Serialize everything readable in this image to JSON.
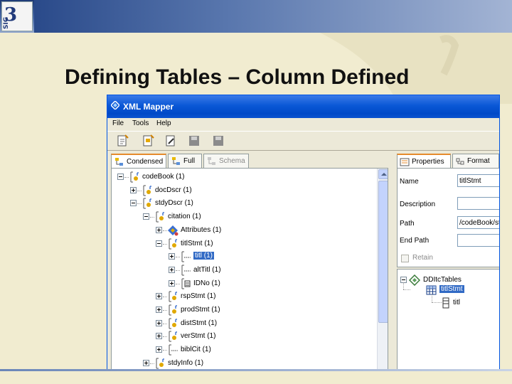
{
  "slide": {
    "title": "Defining Tables – Column Defined",
    "logo_text": "3",
    "logo_sub": "SIG"
  },
  "window": {
    "title": "XML Mapper",
    "menu": [
      "File",
      "Tools",
      "Help"
    ]
  },
  "left_tabs": [
    {
      "label": "Condensed",
      "icon": "tree-icon"
    },
    {
      "label": "Full",
      "icon": "tree-icon"
    },
    {
      "label": "Schema",
      "icon": "schema-icon"
    }
  ],
  "tree": [
    {
      "label": "codeBook (1)",
      "icon": "element-icon",
      "level": 0,
      "expander": "minus"
    },
    {
      "label": "docDscr (1)",
      "icon": "element-icon",
      "level": 1,
      "expander": "plus"
    },
    {
      "label": "stdyDscr (1)",
      "icon": "element-icon",
      "level": 1,
      "expander": "minus"
    },
    {
      "label": "citation (1)",
      "icon": "element-icon",
      "level": 2,
      "expander": "minus"
    },
    {
      "label": "Attributes (1)",
      "icon": "attributes-icon",
      "level": 3,
      "expander": "plus"
    },
    {
      "label": "titlStmt (1)",
      "icon": "element-icon",
      "level": 3,
      "expander": "minus"
    },
    {
      "label": "titl (1)",
      "icon": "text-icon",
      "level": 4,
      "expander": "plus",
      "selected": true
    },
    {
      "label": "altTitl (1)",
      "icon": "text-icon",
      "level": 4,
      "expander": "plus"
    },
    {
      "label": "IDNo (1)",
      "icon": "idno-icon",
      "level": 4,
      "expander": "plus"
    },
    {
      "label": "rspStmt (1)",
      "icon": "element-icon",
      "level": 3,
      "expander": "plus"
    },
    {
      "label": "prodStmt (1)",
      "icon": "element-icon",
      "level": 3,
      "expander": "plus"
    },
    {
      "label": "distStmt (1)",
      "icon": "element-icon",
      "level": 3,
      "expander": "plus"
    },
    {
      "label": "verStmt (1)",
      "icon": "element-icon",
      "level": 3,
      "expander": "plus"
    },
    {
      "label": "biblCit (1)",
      "icon": "text-icon",
      "level": 3,
      "expander": "plus"
    },
    {
      "label": "stdyInfo (1)",
      "icon": "element-icon",
      "level": 2,
      "expander": "plus"
    }
  ],
  "right_tabs": [
    {
      "label": "Properties",
      "icon": "properties-icon"
    },
    {
      "label": "Format",
      "icon": "format-icon"
    }
  ],
  "properties": {
    "name_label": "Name",
    "name_value": "titlStmt",
    "description_label": "Description",
    "description_value": "",
    "path_label": "Path",
    "path_value": "/codeBook/st",
    "endpath_label": "End Path",
    "endpath_value": "",
    "retain_label": "Retain",
    "retain_checked": false
  },
  "tables_tree": {
    "root": "DDItcTables",
    "table": "titlStmt",
    "column": "titl"
  }
}
